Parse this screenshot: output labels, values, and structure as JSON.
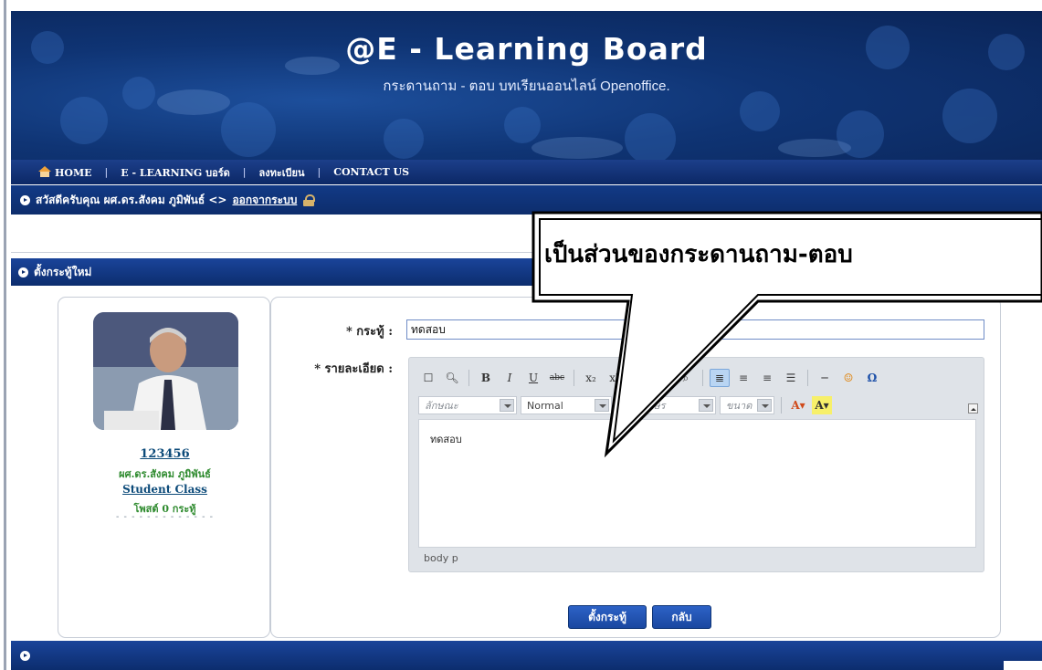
{
  "banner": {
    "title": "@E - Learning Board",
    "subtitle": "กระดานถาม - ตอบ บทเรียนออนไลน์ Openoffice."
  },
  "nav": {
    "items": [
      {
        "label": "HOME"
      },
      {
        "label": "E - LEARNING บอร์ด"
      },
      {
        "label": "ลงทะเบียน"
      },
      {
        "label": "CONTACT US"
      }
    ],
    "separator": "|"
  },
  "welcome": {
    "text": "สวัสดีครับคุณ ผศ.ดร.สังคม ภูมิพันธ์ <>",
    "logout_link": "ออกจากระบบ"
  },
  "section": {
    "title": "ตั้งกระทู้ใหม่"
  },
  "profile": {
    "user_id": "123456",
    "name": "ผศ.ดร.สังคม ภูมิพันธ์",
    "class": "Student Class",
    "posts": "โพสต์ 0 กระทู้",
    "divider": "- - - - - - - - - - - - -"
  },
  "form": {
    "subject_label": "* กระทู้ :",
    "subject_value": "ทดสอบ",
    "detail_label": "* รายละเอียด :",
    "editor": {
      "style_placeholder": "ลักษณะ",
      "format_value": "Normal",
      "font_placeholder": "แบบอักษร",
      "size_placeholder": "ขนาด",
      "content": "ทดสอบ",
      "path": "body  p"
    },
    "submit_label": "ตั้งกระทู้",
    "back_label": "กลับ"
  },
  "callout": {
    "text": "เป็นส่วนของกระดานถาม-ตอบ"
  },
  "colors": {
    "header_blue": "#0f3474",
    "link_blue": "#0d4b7a",
    "green_text": "#2f8b2f"
  }
}
